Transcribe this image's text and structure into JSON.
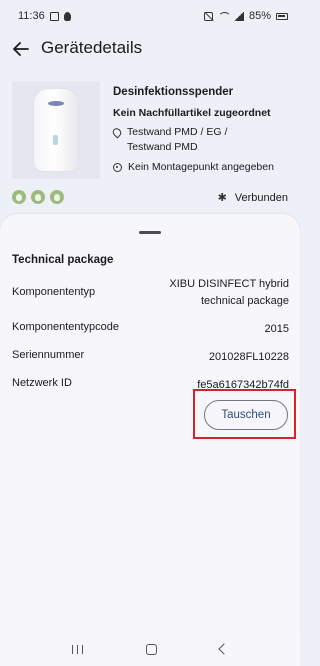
{
  "status_bar": {
    "time": "11:36",
    "battery": "85%"
  },
  "header": {
    "title": "Gerätedetails",
    "back_icon": "arrow-left-icon"
  },
  "device": {
    "name": "Desinfektionsspender",
    "refill": "Kein Nachfüllartikel zugeordnet",
    "location_line1": "Testwand PMD / EG /",
    "location_line2": "Testwand PMD",
    "mount": "Kein Montagepunkt angegeben",
    "connection": "Verbunden",
    "icons": [
      "location-pin-icon",
      "mount-point-icon",
      "bluetooth-icon",
      "eco-badge-icon"
    ]
  },
  "sheet": {
    "title": "Technical package",
    "rows": [
      {
        "label": "Komponententyp",
        "value_line1": "XIBU DISINFECT hybrid",
        "value_line2": "technical package"
      },
      {
        "label": "Komponententypcode",
        "value": "2015"
      },
      {
        "label": "Seriennummer",
        "value": "201028FL10228"
      },
      {
        "label": "Netzwerk ID",
        "value": "fe5a6167342b74fd"
      }
    ],
    "swap_button": "Tauschen"
  },
  "colors": {
    "accent": "#2f4f76",
    "highlight": "#d6222a",
    "eco_green": "#9dba82"
  }
}
